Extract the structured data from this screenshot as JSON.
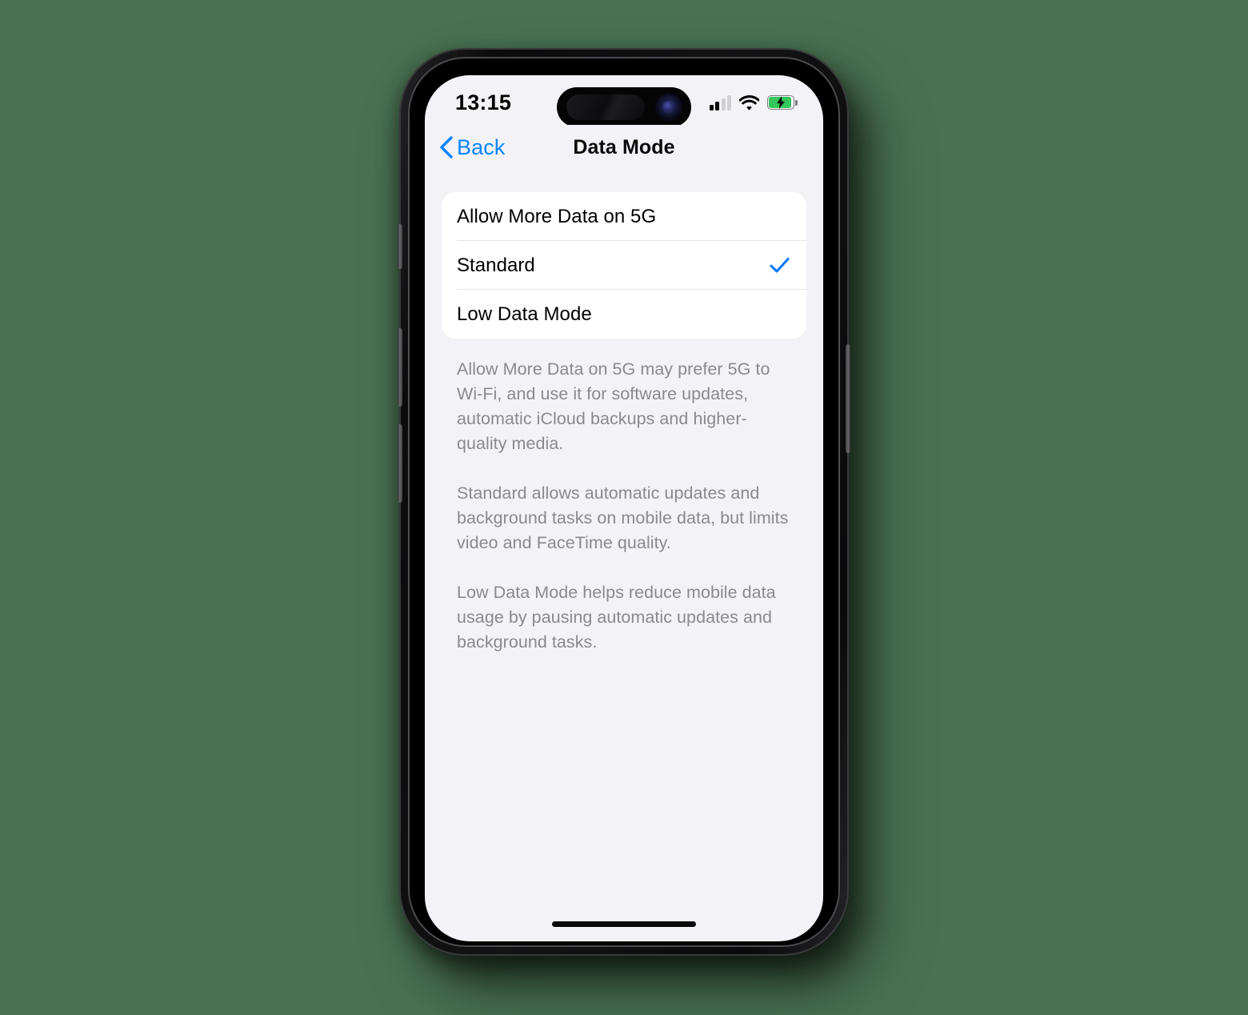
{
  "device": {
    "side_buttons": {
      "action": "action-button",
      "volume_up": "volume-up-button",
      "volume_down": "volume-down-button",
      "power": "power-button"
    }
  },
  "status_bar": {
    "time": "13:15",
    "signal": {
      "icon": "cellular-signal-icon",
      "bars_total": 4,
      "bars_active": 2
    },
    "wifi": {
      "icon": "wifi-icon",
      "strength": 3
    },
    "battery": {
      "icon": "battery-charging-icon",
      "charging": true,
      "fill_percent": 85,
      "color": "#34c759"
    }
  },
  "nav_bar": {
    "back_label": "Back",
    "back_icon": "chevron-left-icon",
    "title": "Data Mode",
    "accent_color": "#0a84ff"
  },
  "options": {
    "selected_index": 1,
    "check_color": "#007aff",
    "items": [
      {
        "label": "Allow More Data on 5G",
        "checked": false
      },
      {
        "label": "Standard",
        "checked": true
      },
      {
        "label": "Low Data Mode",
        "checked": false
      }
    ]
  },
  "footer": {
    "paragraphs": [
      "Allow More Data on 5G may prefer 5G to Wi-Fi, and use it for software updates, automatic iCloud backups and higher-quality media.",
      "Standard allows automatic updates and background tasks on mobile data, but limits video and FaceTime quality.",
      "Low Data Mode helps reduce mobile data usage by pausing automatic updates and background tasks."
    ]
  },
  "theme": {
    "page_background": "#4a7252",
    "screen_background": "#f2f2f7",
    "card_background": "#ffffff",
    "footer_text_color": "#8a8a8e"
  }
}
